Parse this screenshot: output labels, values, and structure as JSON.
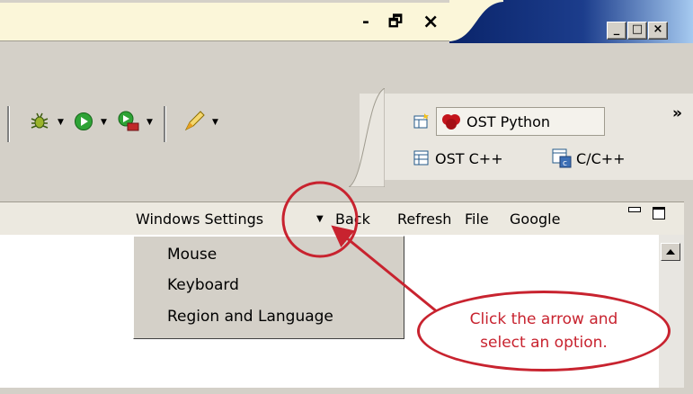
{
  "titlebar": {
    "inner_minimize": "-",
    "inner_restore": "🗗",
    "inner_close": "×",
    "outer_minimize": "_",
    "outer_maximize": "□",
    "outer_close": "×"
  },
  "toolbar": {
    "overflow_label": "»",
    "items": [
      {
        "icon": "debug-bug-icon",
        "has_dropdown": true
      },
      {
        "icon": "run-icon",
        "has_dropdown": true
      },
      {
        "icon": "external-tools-icon",
        "has_dropdown": true
      },
      {
        "icon": "highlighter-icon",
        "has_dropdown": true
      }
    ]
  },
  "perspectives": {
    "items": [
      {
        "label": "OST Python",
        "icon": "python-perspective-icon",
        "active": true
      },
      {
        "label": "OST C++",
        "icon": "table-perspective-icon",
        "active": false
      },
      {
        "label": "C/C++",
        "icon": "cpp-perspective-icon",
        "active": false
      }
    ]
  },
  "view": {
    "menu_links": [
      "Windows Settings",
      "Back",
      "Refresh",
      "File",
      "Google"
    ],
    "dropdown_marker": "▼"
  },
  "dropdown": {
    "items": [
      "Mouse",
      "Keyboard",
      "Region and Language"
    ]
  },
  "annotation": {
    "callout_line1": "Click the arrow and",
    "callout_line2": "select an option.",
    "color": "#c8232f"
  }
}
